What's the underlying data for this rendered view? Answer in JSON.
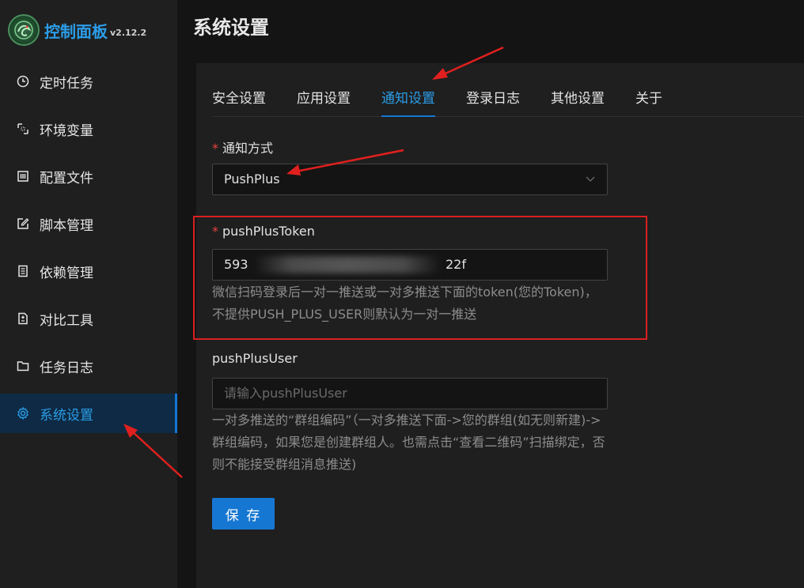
{
  "app": {
    "title": "控制面板",
    "version": "v2.12.2"
  },
  "sidebar": {
    "items": [
      {
        "label": "定时任务",
        "icon": "clock-icon"
      },
      {
        "label": "环境变量",
        "icon": "variable-icon"
      },
      {
        "label": "配置文件",
        "icon": "config-icon"
      },
      {
        "label": "脚本管理",
        "icon": "edit-icon"
      },
      {
        "label": "依赖管理",
        "icon": "package-icon"
      },
      {
        "label": "对比工具",
        "icon": "diff-icon"
      },
      {
        "label": "任务日志",
        "icon": "folder-icon"
      },
      {
        "label": "系统设置",
        "icon": "gear-icon"
      }
    ],
    "active_index": 7
  },
  "page": {
    "title": "系统设置"
  },
  "tabs": [
    "安全设置",
    "应用设置",
    "通知设置",
    "登录日志",
    "其他设置",
    "关于"
  ],
  "active_tab": 2,
  "form": {
    "method": {
      "label": "通知方式",
      "required_mark": "*",
      "value": "PushPlus"
    },
    "token": {
      "label": "pushPlusToken",
      "required_mark": "*",
      "value_start": "593",
      "value_end": "22f",
      "help": "微信扫码登录后一对一推送或一对多推送下面的token(您的Token)，不提供PUSH_PLUS_USER则默认为一对一推送"
    },
    "user": {
      "label": "pushPlusUser",
      "placeholder": "请输入pushPlusUser",
      "help": "一对多推送的“群组编码”（一对多推送下面->您的群组(如无则新建)->群组编码，如果您是创建群组人。也需点击“查看二维码”扫描绑定，否则不能接受群组消息推送)"
    },
    "save_label": "保 存"
  },
  "colors": {
    "accent": "#1677d2",
    "accent_text": "#2b9de8",
    "required": "#e8433d",
    "annotation": "#d92020",
    "background": "#141414",
    "panel": "#1f1f1f"
  }
}
